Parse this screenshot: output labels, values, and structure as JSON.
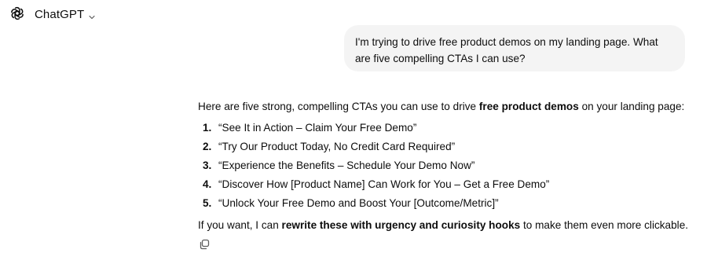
{
  "header": {
    "model_name": "ChatGPT",
    "logo_icon": "openai-logo-icon",
    "chevron_icon": "chevron-down-icon"
  },
  "user_message": {
    "text": "I'm trying to drive free product demos on my landing page. What are five compelling CTAs I can use?"
  },
  "assistant_message": {
    "intro_before": "Here are five strong, compelling CTAs you can use to drive ",
    "intro_bold": "free product demos",
    "intro_after": " on your landing page:",
    "items": [
      {
        "number": "1.",
        "text": "“See It in Action – Claim Your Free Demo”"
      },
      {
        "number": "2.",
        "text": "“Try Our Product Today, No Credit Card Required”"
      },
      {
        "number": "3.",
        "text": "“Experience the Benefits – Schedule Your Demo Now”"
      },
      {
        "number": "4.",
        "text": "“Discover How [Product Name] Can Work for You – Get a Free Demo”"
      },
      {
        "number": "5.",
        "text": "“Unlock Your Free Demo and Boost Your [Outcome/Metric]”"
      }
    ],
    "outro_before": "If you want, I can ",
    "outro_bold": "rewrite these with urgency and curiosity hooks",
    "outro_after": " to make them even more clickable."
  },
  "actions": {
    "copy_icon": "copy-icon"
  },
  "colors": {
    "text": "#0d0d0d",
    "bubble_bg": "#f4f4f4",
    "icon": "#5d5d5d"
  }
}
